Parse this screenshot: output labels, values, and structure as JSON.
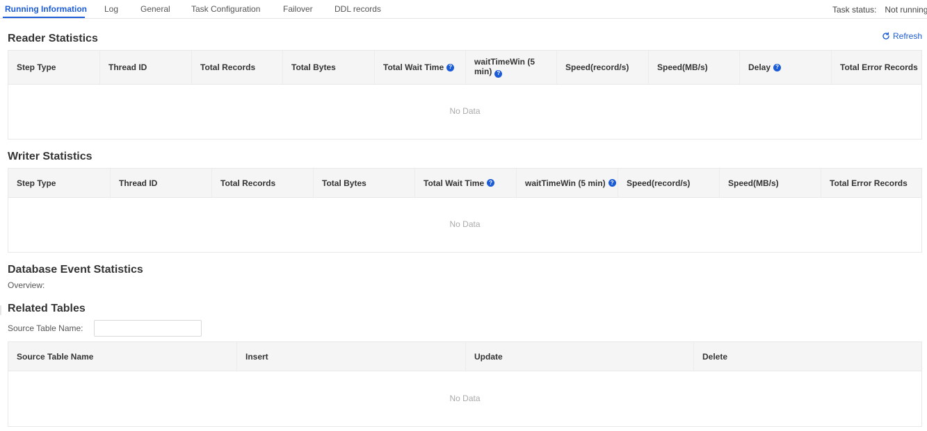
{
  "tabs": [
    "Running Information",
    "Log",
    "General",
    "Task Configuration",
    "Failover",
    "DDL records"
  ],
  "status": {
    "label": "Task status:",
    "value": "Not running"
  },
  "refresh_label": "Refresh",
  "reader": {
    "title": "Reader Statistics",
    "columns": [
      "Step Type",
      "Thread ID",
      "Total Records",
      "Total Bytes",
      "Total Wait Time",
      "waitTimeWin (5 min)",
      "Speed(record/s)",
      "Speed(MB/s)",
      "Delay",
      "Total Error Records"
    ],
    "empty": "No Data"
  },
  "writer": {
    "title": "Writer Statistics",
    "columns": [
      "Step Type",
      "Thread ID",
      "Total Records",
      "Total Bytes",
      "Total Wait Time",
      "waitTimeWin (5 min)",
      "Speed(record/s)",
      "Speed(MB/s)",
      "Total Error Records"
    ],
    "empty": "No Data"
  },
  "db_events": {
    "title": "Database Event Statistics",
    "overview_label": "Overview:"
  },
  "related": {
    "title": "Related Tables",
    "filter_label": "Source Table Name:",
    "filter_value": "",
    "columns": [
      "Source Table Name",
      "Insert",
      "Update",
      "Delete"
    ],
    "empty": "No Data"
  },
  "icons": {
    "help": "question-circle-icon",
    "refresh": "refresh-icon"
  },
  "colors": {
    "accent": "#1b5bd6",
    "header_bg": "#f5f5f5",
    "border": "#e8e8e8"
  }
}
